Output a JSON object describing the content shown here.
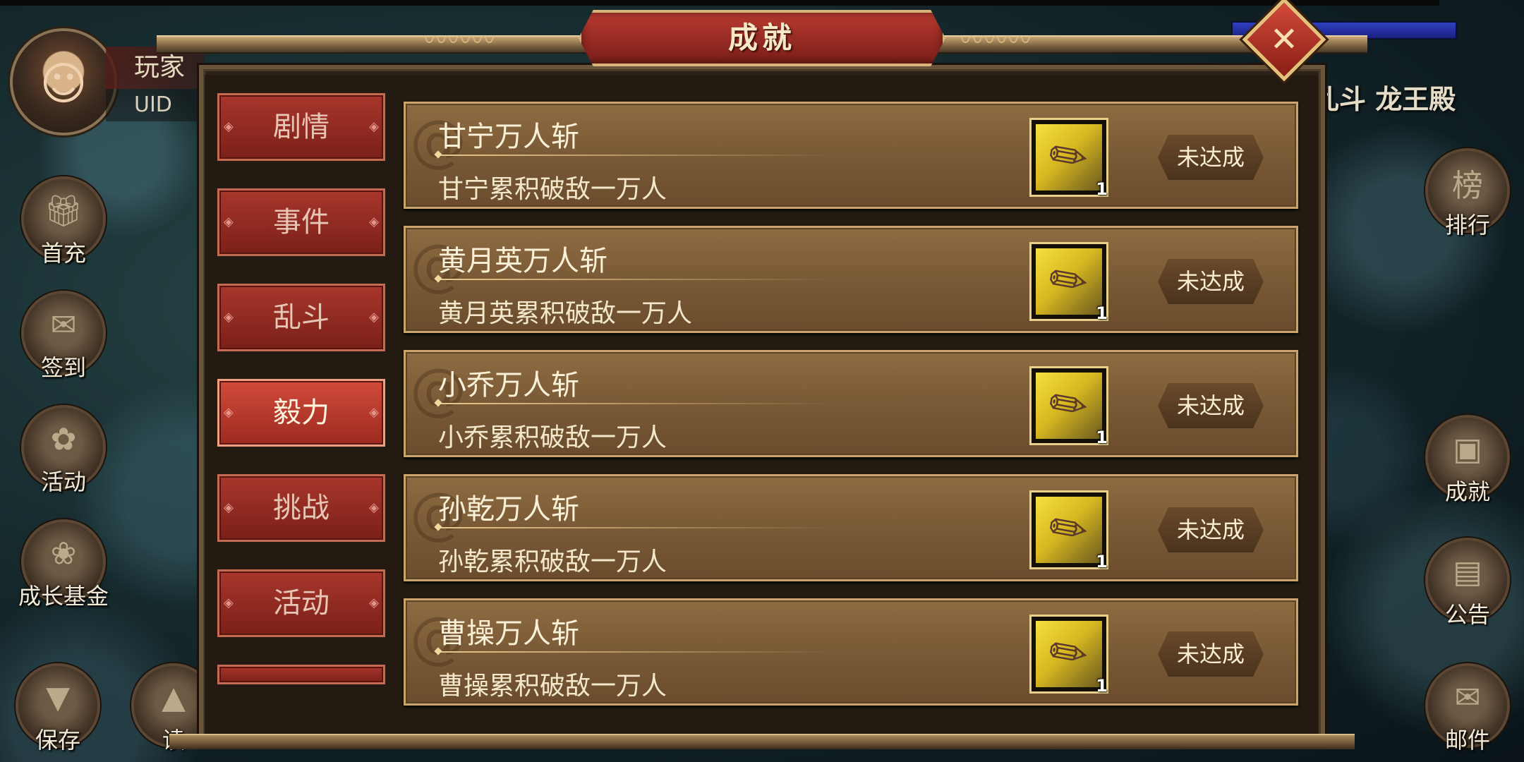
{
  "player": {
    "name_label": "玩家",
    "uid_label": "UID"
  },
  "left_menu": [
    {
      "label": "首充",
      "icon": "gift-icon"
    },
    {
      "label": "签到",
      "icon": "book-icon"
    },
    {
      "label": "活动",
      "icon": "flower-basket-icon"
    },
    {
      "label": "成长基金",
      "icon": "plant-icon"
    },
    {
      "label": "保存",
      "icon": "save-icon"
    },
    {
      "label": "读",
      "icon": "load-icon"
    }
  ],
  "right_menu": [
    {
      "label": "排行",
      "icon": "ranking-board-icon"
    },
    {
      "label": "成就",
      "icon": "achievement-icon"
    },
    {
      "label": "公告",
      "icon": "scroll-icon"
    },
    {
      "label": "邮件",
      "icon": "mail-icon"
    }
  ],
  "right_top_text": "乱斗 龙王殿",
  "dialog": {
    "title": "成就",
    "close_icon": "close-icon"
  },
  "tabs": [
    {
      "label": "剧情",
      "active": false
    },
    {
      "label": "事件",
      "active": false
    },
    {
      "label": "乱斗",
      "active": false
    },
    {
      "label": "毅力",
      "active": true
    },
    {
      "label": "挑战",
      "active": false
    },
    {
      "label": "活动",
      "active": false
    },
    {
      "label": "",
      "active": false
    }
  ],
  "achievements": [
    {
      "name": "甘宁万人斩",
      "desc": "甘宁累积破敌一万人",
      "reward_qty": "1",
      "reward_icon": "brush-scroll-icon",
      "status": "未达成"
    },
    {
      "name": "黄月英万人斩",
      "desc": "黄月英累积破敌一万人",
      "reward_qty": "1",
      "reward_icon": "brush-scroll-icon",
      "status": "未达成"
    },
    {
      "name": "小乔万人斩",
      "desc": "小乔累积破敌一万人",
      "reward_qty": "1",
      "reward_icon": "brush-scroll-icon",
      "status": "未达成"
    },
    {
      "name": "孙乾万人斩",
      "desc": "孙乾累积破敌一万人",
      "reward_qty": "1",
      "reward_icon": "brush-scroll-icon",
      "status": "未达成"
    },
    {
      "name": "曹操万人斩",
      "desc": "曹操累积破敌一万人",
      "reward_qty": "1",
      "reward_icon": "brush-scroll-icon",
      "status": "未达成"
    }
  ],
  "colors": {
    "tab_active": "#d14b3a",
    "tab_inactive": "#a8362c",
    "row_bg": "#7a5a36",
    "reward_gold": "#f4e040"
  }
}
